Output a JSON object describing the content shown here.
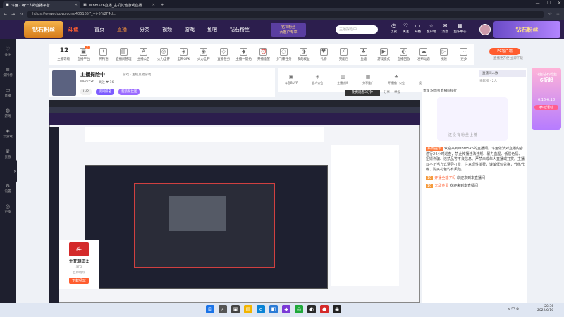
{
  "browser": {
    "tabs": [
      {
        "label": "斗鱼 - 每个人的直播平台",
        "active": true
      },
      {
        "label": "Mibm5x6直播_主机其他游戏直播",
        "active": false
      }
    ],
    "new_tab": "+",
    "url": "https://www.douyu.com/4051657_=(-5%2F4d... ",
    "win_min": "—",
    "win_max": "☐",
    "win_close": "✕"
  },
  "header": {
    "logo_badge": "钻石粉丝",
    "logo_brand": "斗鱼",
    "nav": [
      "首页",
      "直播",
      "分类",
      "视频",
      "游戏",
      "鱼吧",
      "钻石粉丝"
    ],
    "nav_selected": 1,
    "diamond_promo_top": "钻石粉丝",
    "diamond_promo_bottom": "大客户专享",
    "search_placeholder": "主播探险中",
    "icons": [
      {
        "icon": "clock-icon",
        "label": "历史"
      },
      {
        "icon": "heart-icon",
        "label": "关注"
      },
      {
        "icon": "tv-icon",
        "label": "开播"
      },
      {
        "icon": "star-icon",
        "label": "客户端"
      },
      {
        "icon": "chat-icon",
        "label": "消息"
      },
      {
        "icon": "grid-icon",
        "label": "鱼乐中心"
      }
    ],
    "right_promo": "钻石粉丝"
  },
  "left_sidebar": [
    {
      "icon": "heart-icon",
      "label": "关注"
    },
    {
      "icon": "list-icon",
      "label": "排行榜"
    },
    {
      "icon": "tv-icon",
      "label": "直播"
    },
    {
      "icon": "game-icon",
      "label": "游戏"
    },
    {
      "icon": "tag-icon",
      "label": "云游戏"
    },
    {
      "icon": "crown-icon",
      "label": "贵族"
    },
    {
      "icon": "gear-icon",
      "label": "设置"
    },
    {
      "icon": "globe-icon",
      "label": "更多"
    }
  ],
  "toolbar": {
    "items": [
      {
        "label": "主播等级",
        "icon": "12",
        "level": true
      },
      {
        "label": "直播平台",
        "icon": "▣",
        "badge": "2"
      },
      {
        "label": "鸭鸭语",
        "icon": "✦"
      },
      {
        "label": "直播间管理",
        "icon": "▤"
      },
      {
        "label": "主播公告",
        "icon": "A"
      },
      {
        "label": "火力全开",
        "icon": "◎"
      },
      {
        "label": "全网GPK",
        "icon": "◈"
      },
      {
        "label": "火力全开",
        "icon": "◉"
      },
      {
        "label": "直播任务",
        "icon": "◇"
      },
      {
        "label": "主播一键拍",
        "icon": "◆"
      },
      {
        "label": "开播提醒",
        "icon": "⏰"
      },
      {
        "label": "小飞碟任务",
        "icon": "◌"
      },
      {
        "label": "我的权益",
        "icon": "◑"
      },
      {
        "label": "礼物",
        "icon": "♥"
      },
      {
        "label": "充能包",
        "icon": "⚡"
      },
      {
        "label": "鱼塘",
        "icon": "♣"
      },
      {
        "label": "游戏模式",
        "icon": "▶"
      },
      {
        "label": "直播回放",
        "icon": "◐"
      },
      {
        "label": "发布动态",
        "icon": "☁"
      },
      {
        "label": "视频",
        "icon": "▷"
      },
      {
        "label": "更多",
        "icon": "⋯"
      }
    ],
    "pc_client_button": "PC客户端",
    "pc_client_sub": "直播更方便 立即下载"
  },
  "room": {
    "title": "主播探险中",
    "category": "游戏 · 主机其他游戏",
    "id_row": [
      "MBm5x6",
      "关注 ♥ 16"
    ],
    "level_pill": "LV2",
    "btn_a": "房间排名",
    "btn_b": "超级粉丝团",
    "play_button": "免费观看3分钟",
    "share": "分享",
    "report": "举报"
  },
  "host_tools": [
    {
      "icon": "▣",
      "label": "斗鱼BUFF"
    },
    {
      "icon": "◈",
      "label": "超人公会"
    },
    {
      "icon": "▥",
      "label": "主播房间"
    },
    {
      "icon": "▦",
      "label": "分享推广"
    },
    {
      "icon": "♣",
      "label": "开播推广公会"
    },
    {
      "icon": "✦",
      "label": "设置直播模式"
    },
    {
      "icon": "◎",
      "label": "设置直播密码"
    }
  ],
  "right_panel": {
    "rank_label": "直播间人数",
    "rank_sub": "贡献榜 · 2人",
    "tab_line": "贵宾 粉丝团 直播间排行",
    "art_text": "还没有粉丝上榜",
    "chat": [
      {
        "badge": "系统提示",
        "name": "",
        "text": "欢迎来到MBm5x6的直播间。斗鱼依法对直播内容进行24小时巡查，禁止传播违法违规、暴力血腥、低俗色情、招嫖诈骗、违禁品等不良信息。严禁未成年人直播或打赏。主播以不正当方式诱导打赏，注意理性消费，谨慎低价兑换，代练代练、购买礼包均有风险。"
      },
      {
        "badge": "10",
        "name": "开播全能了吗",
        "text": "欢迎来到本直播间"
      },
      {
        "badge": "10",
        "name": "无敌金蛋",
        "text": "欢迎来到本直播间"
      }
    ],
    "promo_top": "斗鱼钻石粉丝",
    "promo_big": "6折起",
    "promo_date": "6.16-6.18",
    "promo_btn": "参与活动"
  },
  "promo_card": {
    "logo": "斗",
    "title": "生死狙击2",
    "line1": "STG",
    "line2": "立即畅玩",
    "button": "下载畅玩"
  },
  "taskbar": {
    "time": "20:36",
    "date": "2022/6/16",
    "sys": "∧ 中 ⊕"
  }
}
